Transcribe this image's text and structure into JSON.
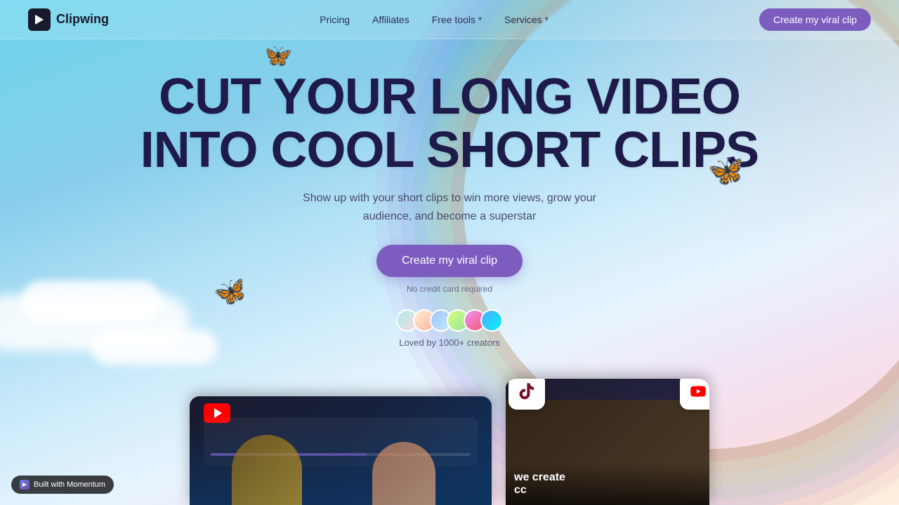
{
  "brand": {
    "name": "Clipwing",
    "logo_alt": "Clipwing logo"
  },
  "nav": {
    "links": [
      {
        "id": "pricing",
        "label": "Pricing"
      },
      {
        "id": "affiliates",
        "label": "Affiliates"
      },
      {
        "id": "free-tools",
        "label": "Free tools",
        "has_dropdown": true
      },
      {
        "id": "services",
        "label": "Services",
        "has_dropdown": true
      }
    ],
    "cta_label": "Create my viral clip"
  },
  "hero": {
    "title_line1": "CUT YOUR LONG VIDEO",
    "title_line2": "INTO COOL SHORT CLIPS",
    "subtitle": "Show up with your short clips to win more views, grow your\naudience, and become a superstar",
    "cta_label": "Create my viral clip",
    "no_credit_card": "No credit card required",
    "loved_text": "Loved by 1000+ creators"
  },
  "preview": {
    "left_card_label": "YouTube video editor",
    "right_card_cc": "we create\ncc"
  },
  "momentum": {
    "label": "Built with Momentum"
  },
  "avatars": [
    {
      "id": 1,
      "initials": ""
    },
    {
      "id": 2,
      "initials": ""
    },
    {
      "id": 3,
      "initials": ""
    },
    {
      "id": 4,
      "initials": ""
    },
    {
      "id": 5,
      "initials": ""
    },
    {
      "id": 6,
      "initials": ""
    }
  ]
}
